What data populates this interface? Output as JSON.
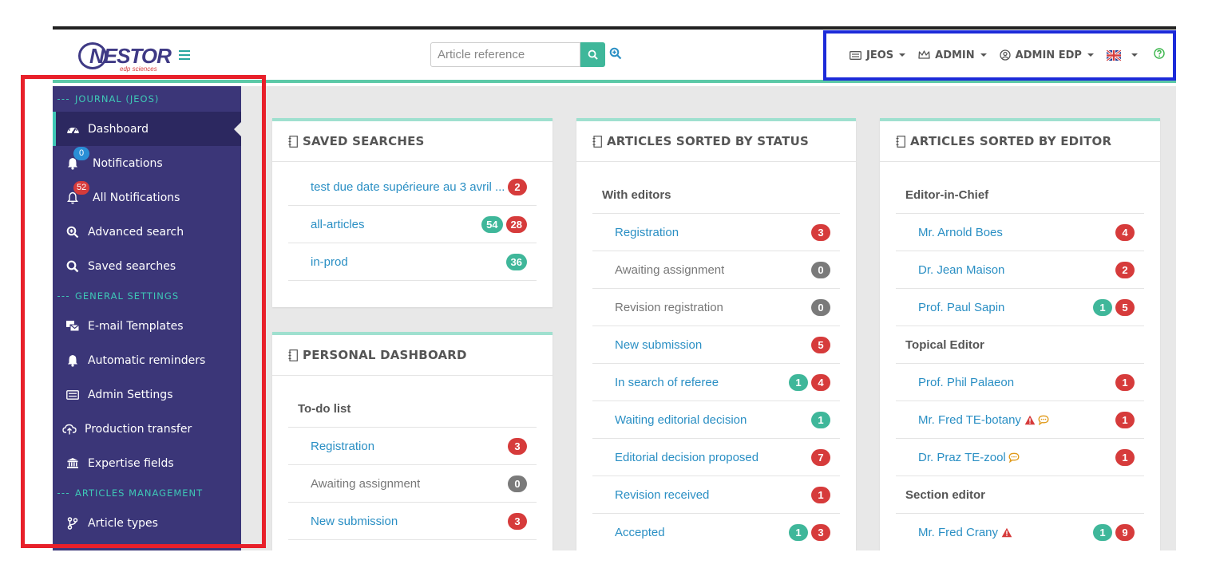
{
  "header": {
    "logo_text": "NESTOR",
    "logo_sub": "edp sciences",
    "search_placeholder": "Article reference",
    "menus": [
      {
        "label": "JEOS",
        "icon": "card-icon"
      },
      {
        "label": "ADMIN",
        "icon": "crown-icon"
      },
      {
        "label": "ADMIN EDP",
        "icon": "user-circle-icon"
      }
    ],
    "language_icon": "uk-flag-icon",
    "help_icon": "help-icon"
  },
  "sidebar": {
    "sections": [
      {
        "title": "JOURNAL (JEOS)",
        "items": [
          {
            "label": "Dashboard",
            "icon": "dashboard-icon",
            "active": true
          },
          {
            "label": "Notifications",
            "icon": "bell-icon",
            "badge": "0"
          },
          {
            "label": "All Notifications",
            "icon": "bell-outline-icon",
            "badge": "52"
          },
          {
            "label": "Advanced search",
            "icon": "zoom-in-icon"
          },
          {
            "label": "Saved searches",
            "icon": "search-icon"
          }
        ]
      },
      {
        "title": "GENERAL SETTINGS",
        "items": [
          {
            "label": "E-mail Templates",
            "icon": "mail-templates-icon"
          },
          {
            "label": "Automatic reminders",
            "icon": "bell-icon"
          },
          {
            "label": "Admin Settings",
            "icon": "card-icon"
          },
          {
            "label": "Production transfer",
            "icon": "cloud-upload-icon"
          },
          {
            "label": "Expertise fields",
            "icon": "institution-icon"
          }
        ]
      },
      {
        "title": "ARTICLES MANAGEMENT",
        "items": [
          {
            "label": "Article types",
            "icon": "branch-icon"
          }
        ]
      }
    ]
  },
  "cards": {
    "saved_searches": {
      "title": "SAVED SEARCHES",
      "rows": [
        {
          "label": "test due date supérieure au 3 avril ...",
          "badges": [
            {
              "v": "2",
              "c": "red"
            }
          ]
        },
        {
          "label": "all-articles",
          "badges": [
            {
              "v": "54",
              "c": "green"
            },
            {
              "v": "28",
              "c": "red"
            }
          ]
        },
        {
          "label": "in-prod",
          "badges": [
            {
              "v": "36",
              "c": "green"
            }
          ]
        }
      ]
    },
    "personal_dashboard": {
      "title": "PERSONAL DASHBOARD",
      "group": "To-do list",
      "rows": [
        {
          "label": "Registration",
          "link": true,
          "badges": [
            {
              "v": "3",
              "c": "red"
            }
          ]
        },
        {
          "label": "Awaiting assignment",
          "link": false,
          "badges": [
            {
              "v": "0",
              "c": "grey"
            }
          ]
        },
        {
          "label": "New submission",
          "link": true,
          "badges": [
            {
              "v": "3",
              "c": "red"
            }
          ]
        }
      ]
    },
    "by_status": {
      "title": "ARTICLES SORTED BY STATUS",
      "group": "With editors",
      "rows": [
        {
          "label": "Registration",
          "link": true,
          "badges": [
            {
              "v": "3",
              "c": "red"
            }
          ]
        },
        {
          "label": "Awaiting assignment",
          "link": false,
          "badges": [
            {
              "v": "0",
              "c": "grey"
            }
          ]
        },
        {
          "label": "Revision registration",
          "link": false,
          "badges": [
            {
              "v": "0",
              "c": "grey"
            }
          ]
        },
        {
          "label": "New submission",
          "link": true,
          "badges": [
            {
              "v": "5",
              "c": "red"
            }
          ]
        },
        {
          "label": "In search of referee",
          "link": true,
          "badges": [
            {
              "v": "1",
              "c": "green"
            },
            {
              "v": "4",
              "c": "red"
            }
          ]
        },
        {
          "label": "Waiting editorial decision",
          "link": true,
          "badges": [
            {
              "v": "1",
              "c": "green"
            }
          ]
        },
        {
          "label": "Editorial decision proposed",
          "link": true,
          "badges": [
            {
              "v": "7",
              "c": "red"
            }
          ]
        },
        {
          "label": "Revision received",
          "link": true,
          "badges": [
            {
              "v": "1",
              "c": "red"
            }
          ]
        },
        {
          "label": "Accepted",
          "link": true,
          "badges": [
            {
              "v": "1",
              "c": "green"
            },
            {
              "v": "3",
              "c": "red"
            }
          ]
        }
      ]
    },
    "by_editor": {
      "title": "ARTICLES SORTED BY EDITOR",
      "groups": [
        {
          "title": "Editor-in-Chief",
          "rows": [
            {
              "label": "Mr. Arnold Boes",
              "badges": [
                {
                  "v": "4",
                  "c": "red"
                }
              ]
            },
            {
              "label": "Dr. Jean Maison",
              "badges": [
                {
                  "v": "2",
                  "c": "red"
                }
              ]
            },
            {
              "label": "Prof. Paul Sapin",
              "badges": [
                {
                  "v": "1",
                  "c": "green"
                },
                {
                  "v": "5",
                  "c": "red"
                }
              ]
            }
          ]
        },
        {
          "title": "Topical Editor",
          "rows": [
            {
              "label": "Prof. Phil Palaeon",
              "badges": [
                {
                  "v": "1",
                  "c": "red"
                }
              ]
            },
            {
              "label": "Mr. Fred TE-botany",
              "warn": true,
              "comment": true,
              "badges": [
                {
                  "v": "1",
                  "c": "red"
                }
              ]
            },
            {
              "label": "Dr. Praz TE-zool",
              "comment": true,
              "badges": [
                {
                  "v": "1",
                  "c": "red"
                }
              ]
            }
          ]
        },
        {
          "title": "Section editor",
          "rows": [
            {
              "label": "Mr. Fred Crany",
              "warn": true,
              "badges": [
                {
                  "v": "1",
                  "c": "green"
                },
                {
                  "v": "9",
                  "c": "red"
                }
              ]
            }
          ]
        }
      ]
    }
  },
  "colors": {
    "sidebar_bg": "#3b3678",
    "accent": "#3ec8b6",
    "link": "#2a8fc4",
    "badge_red": "#d63b3b",
    "badge_green": "#3fb79a",
    "highlight_red": "#e8202a",
    "highlight_blue": "#1c2bd9"
  }
}
